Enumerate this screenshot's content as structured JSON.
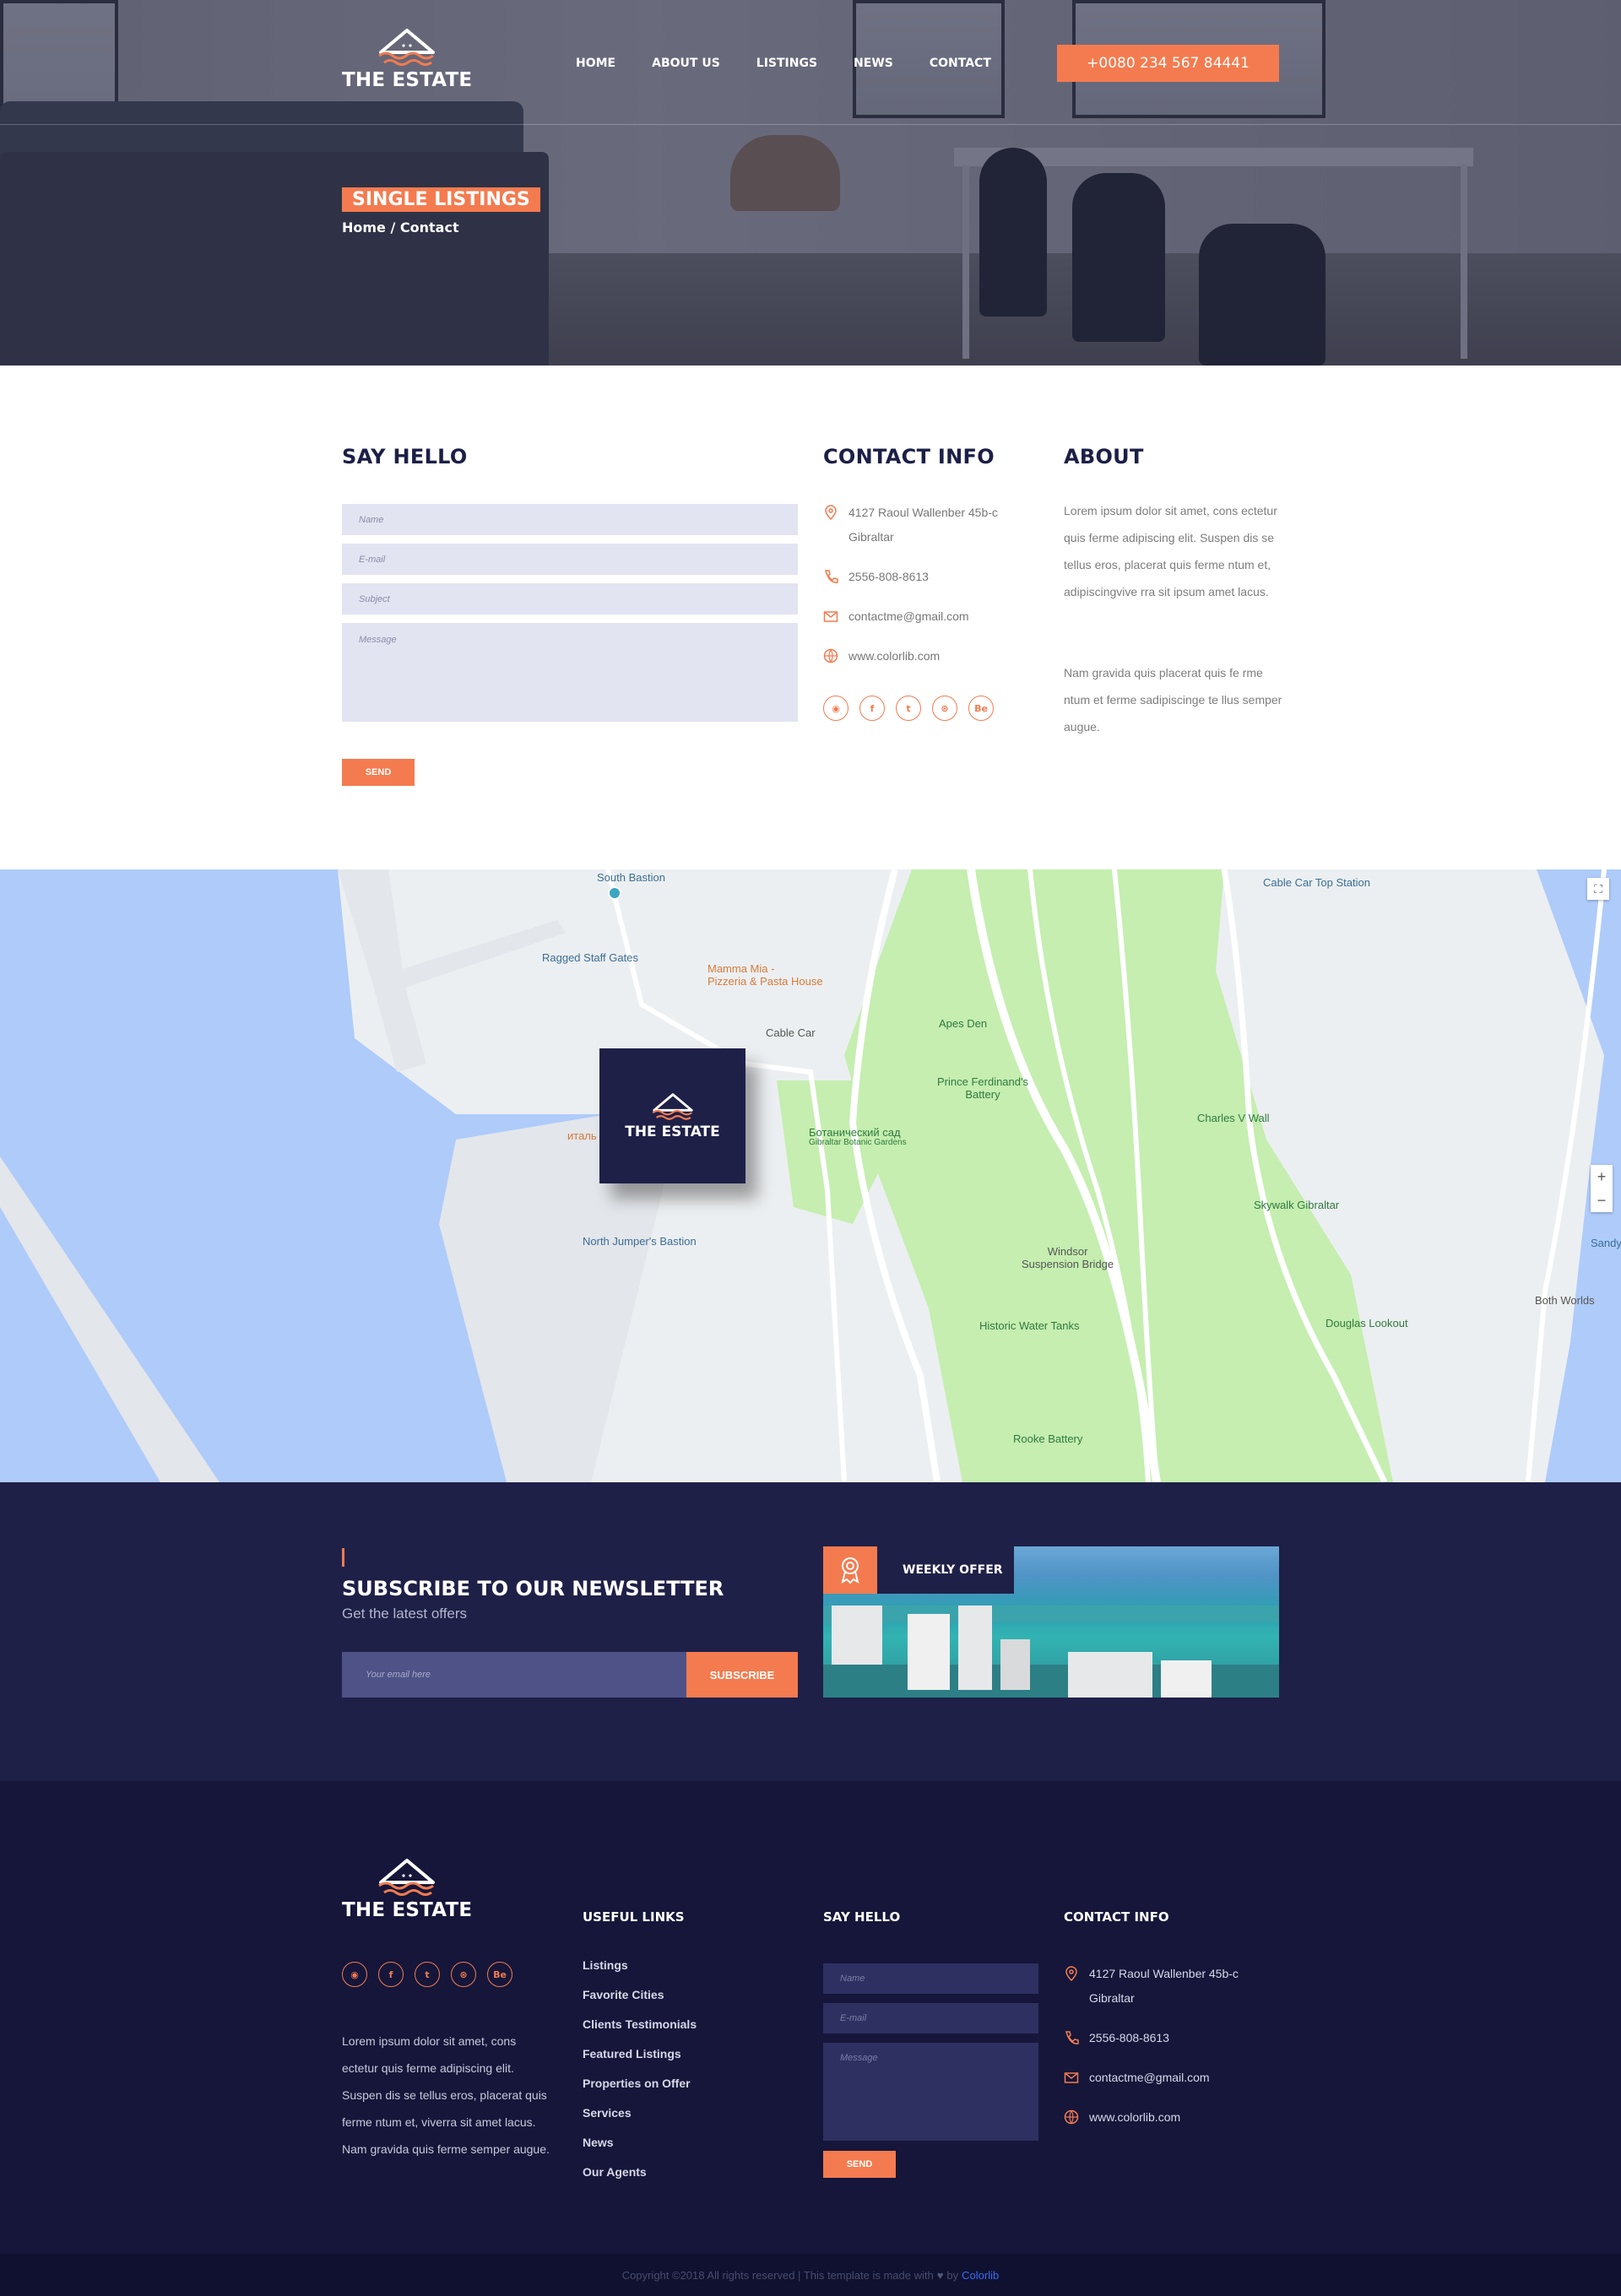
{
  "header": {
    "logo_text": "THE ESTATE",
    "nav": [
      "HOME",
      "ABOUT US",
      "LISTINGS",
      "NEWS",
      "CONTACT"
    ],
    "phone": "+0080 234 567 84441",
    "page_title": "SINGLE LISTINGS",
    "breadcrumb": "Home / Contact"
  },
  "contact_form": {
    "title": "SAY HELLO",
    "name_placeholder": "Name",
    "email_placeholder": "E-mail",
    "subject_placeholder": "Subject",
    "message_placeholder": "Message",
    "send_label": "SEND"
  },
  "contact_info": {
    "title": "CONTACT INFO",
    "address_line1": "4127 Raoul Wallenber 45b-c",
    "address_line2": "Gibraltar",
    "phone": "2556-808-8613",
    "email": "contactme@gmail.com",
    "website": "www.colorlib.com",
    "social": [
      "pinterest-icon",
      "facebook-icon",
      "twitter-icon",
      "dribbble-icon",
      "behance-icon"
    ]
  },
  "about": {
    "title": "ABOUT",
    "p1": "Lorem ipsum dolor sit amet, cons ectetur quis ferme adipiscing elit. Suspen dis se tellus eros, placerat quis ferme ntum et, adipiscingvive rra sit ipsum amet lacus.",
    "p2": "Nam gravida quis placerat quis fe rme ntum et ferme sadipiscinge te llus semper augue."
  },
  "map": {
    "marker_text": "THE ESTATE",
    "labels": {
      "south_bastion": "South Bastion",
      "ragged_staff": "Ragged Staff Gates",
      "mamma_mia": "Mamma Mia -\nPizzeria & Pasta House",
      "cable_car": "Cable Car",
      "cable_car_top": "Cable Car Top Station",
      "apes_den": "Apes Den",
      "prince_ferdinand": "Prince Ferdinand's\nBattery",
      "botanic_ru": "Ботанический сад",
      "botanic_en": "Gibraltar Botanic Gardens",
      "charles_v": "Charles V Wall",
      "skywalk": "Skywalk Gibraltar",
      "north_jumper": "North Jumper's Bastion",
      "windsor": "Windsor\nSuspension Bridge",
      "historic_tanks": "Historic Water Tanks",
      "douglas": "Douglas Lookout",
      "both_worlds": "Both Worlds",
      "rooke": "Rooke Battery",
      "sandy": "Sandy",
      "italian_partial": "италь"
    },
    "zoom_in": "+",
    "zoom_out": "−"
  },
  "newsletter": {
    "title": "SUBSCRIBE TO OUR NEWSLETTER",
    "subtitle": "Get the latest offers",
    "email_placeholder": "Your email here",
    "button": "SUBSCRIBE",
    "offer_label": "WEEKLY OFFER"
  },
  "footer": {
    "logo_text": "THE ESTATE",
    "about_text": "Lorem ipsum dolor sit amet, cons ectetur quis ferme adipiscing elit. Suspen dis se tellus eros, placerat quis ferme ntum et, viverra sit amet lacus. Nam gravida quis ferme semper augue.",
    "useful_links_title": "USEFUL LINKS",
    "links": [
      "Listings",
      "Favorite Cities",
      "Clients Testimonials",
      "Featured Listings",
      "Properties on Offer",
      "Services",
      "News",
      "Our Agents"
    ],
    "say_hello_title": "SAY HELLO",
    "name_placeholder": "Name",
    "email_placeholder": "E-mail",
    "message_placeholder": "Message",
    "send_label": "SEND",
    "contact_title": "CONTACT INFO",
    "address_line1": "4127 Raoul Wallenber 45b-c",
    "address_line2": "Gibraltar",
    "phone": "2556-808-8613",
    "email": "contactme@gmail.com",
    "website": "www.colorlib.com",
    "copyright": "Copyright ©2018 All rights reserved | This template is made with",
    "copyright_by": "by",
    "copyright_brand": "Colorlib"
  },
  "colors": {
    "accent": "#f47b4f",
    "navy": "#1f2048",
    "footer": "#15163a"
  }
}
